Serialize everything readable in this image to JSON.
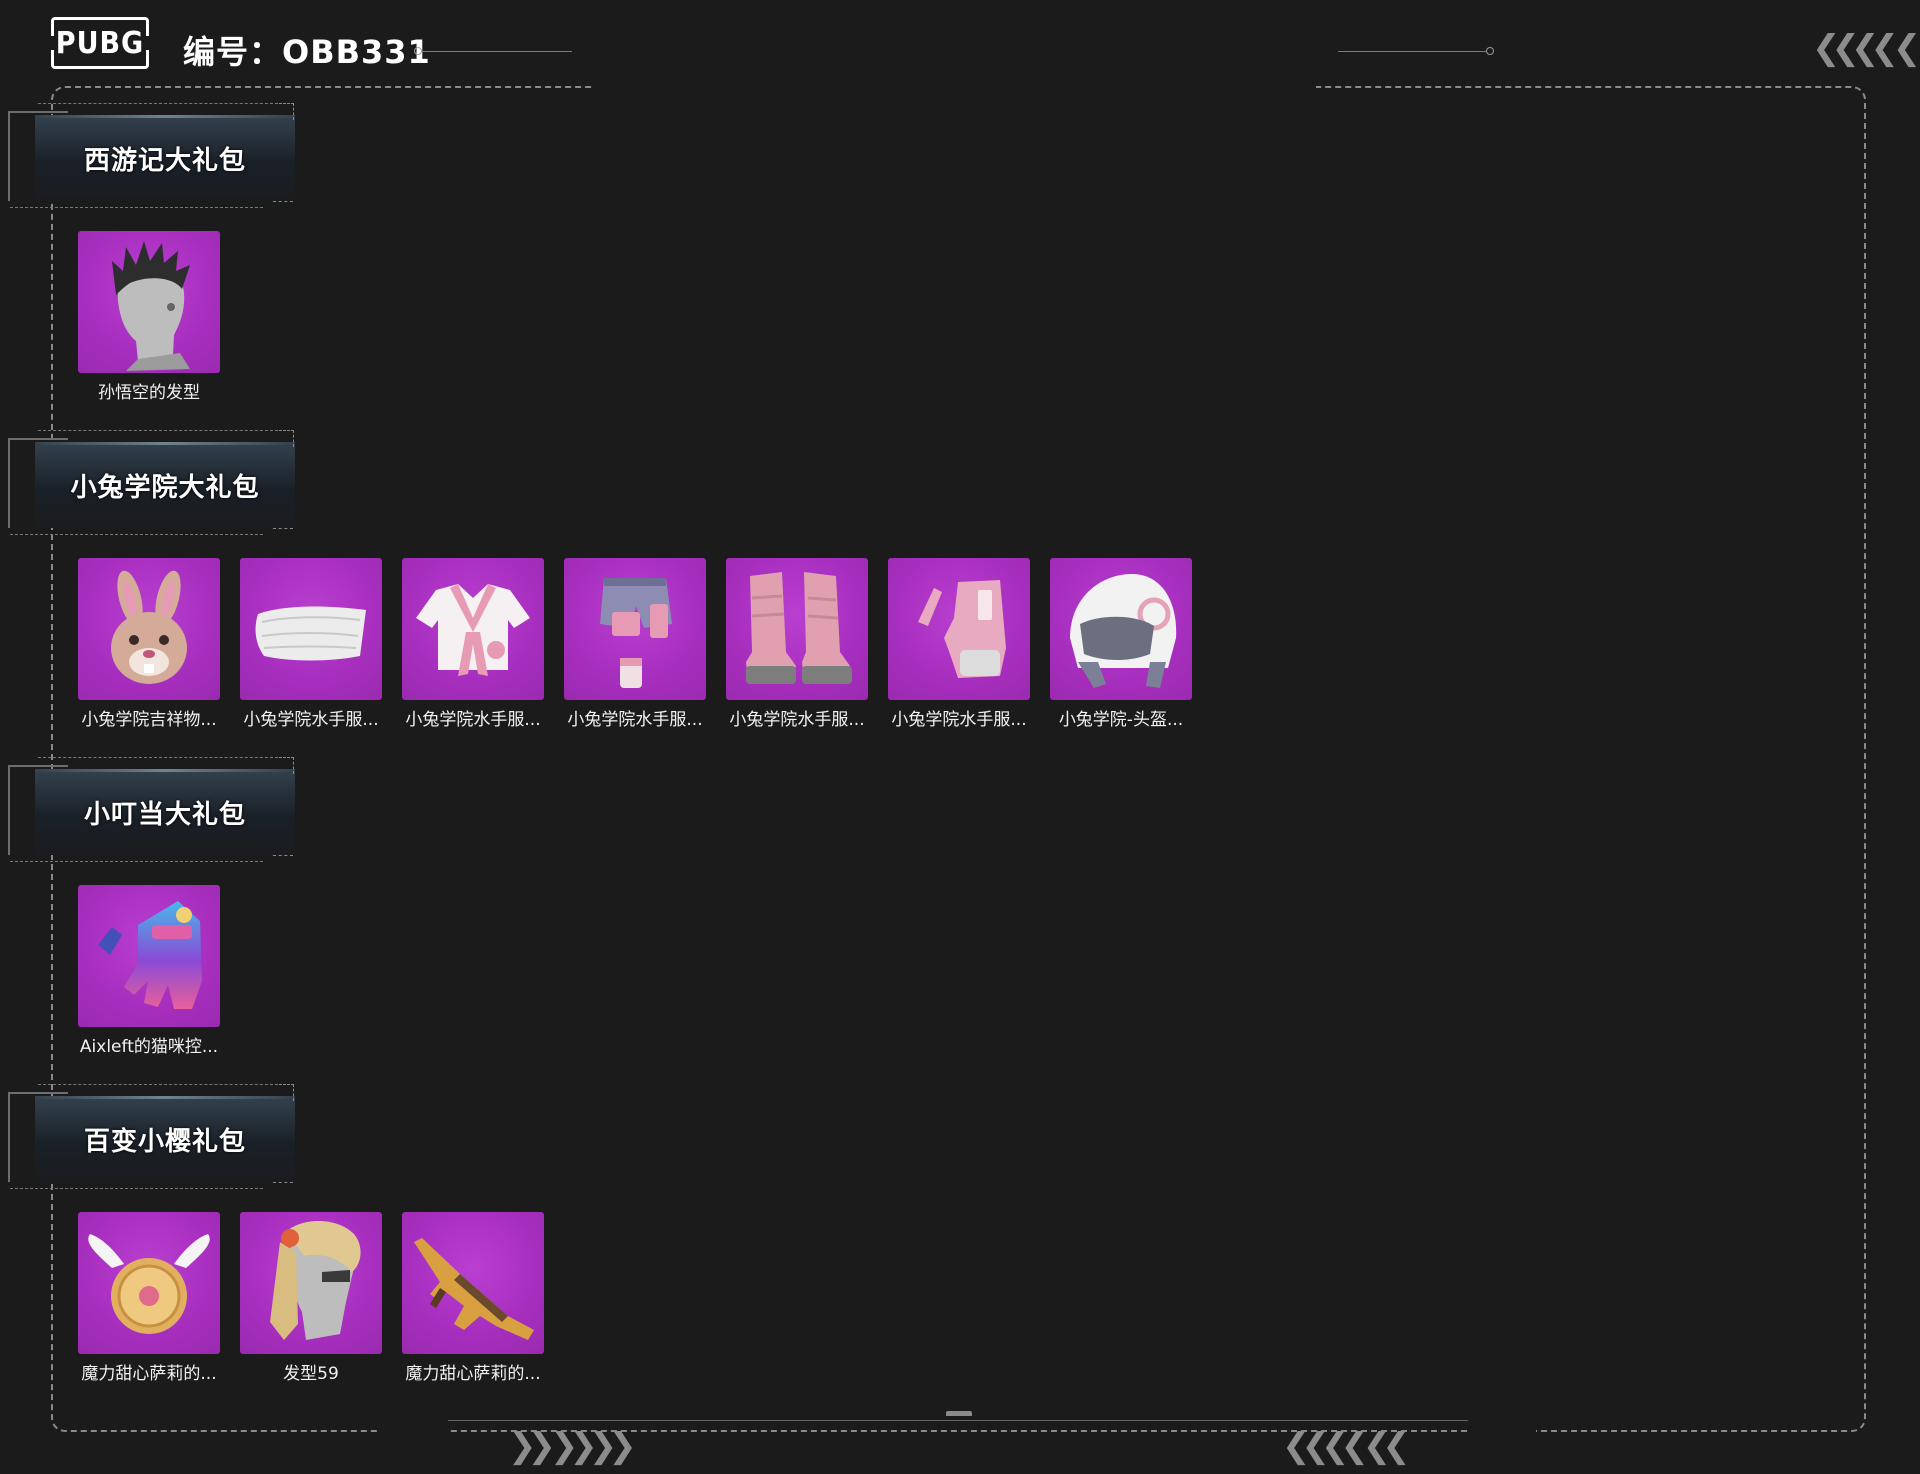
{
  "header": {
    "logo_text": "PUBG",
    "id_label": "编号：OBB331"
  },
  "sections": [
    {
      "title": "西游记大礼包",
      "items": [
        {
          "label": "孙悟空的发型",
          "icon": "hair-icon"
        }
      ]
    },
    {
      "title": "小兔学院大礼包",
      "items": [
        {
          "label": "小兔学院吉祥物...",
          "icon": "bunny-mask-icon"
        },
        {
          "label": "小兔学院水手服...",
          "icon": "face-mask-icon"
        },
        {
          "label": "小兔学院水手服...",
          "icon": "shirt-icon"
        },
        {
          "label": "小兔学院水手服...",
          "icon": "shorts-icon"
        },
        {
          "label": "小兔学院水手服...",
          "icon": "boots-icon"
        },
        {
          "label": "小兔学院水手服...",
          "icon": "glove-icon"
        },
        {
          "label": "小兔学院-头盔...",
          "icon": "helmet-icon"
        }
      ]
    },
    {
      "title": "小叮当大礼包",
      "items": [
        {
          "label": "Aixleft的猫咪控...",
          "icon": "glove-icon"
        }
      ]
    },
    {
      "title": "百变小樱礼包",
      "items": [
        {
          "label": "魔力甜心萨莉的...",
          "icon": "backpack-icon"
        },
        {
          "label": "发型59",
          "icon": "hair-icon"
        },
        {
          "label": "魔力甜心萨莉的...",
          "icon": "rifle-icon"
        }
      ]
    }
  ],
  "colors": {
    "background": "#1b1b1c",
    "tile": "#a82fbf",
    "accent_line": "#8a8a8a"
  }
}
